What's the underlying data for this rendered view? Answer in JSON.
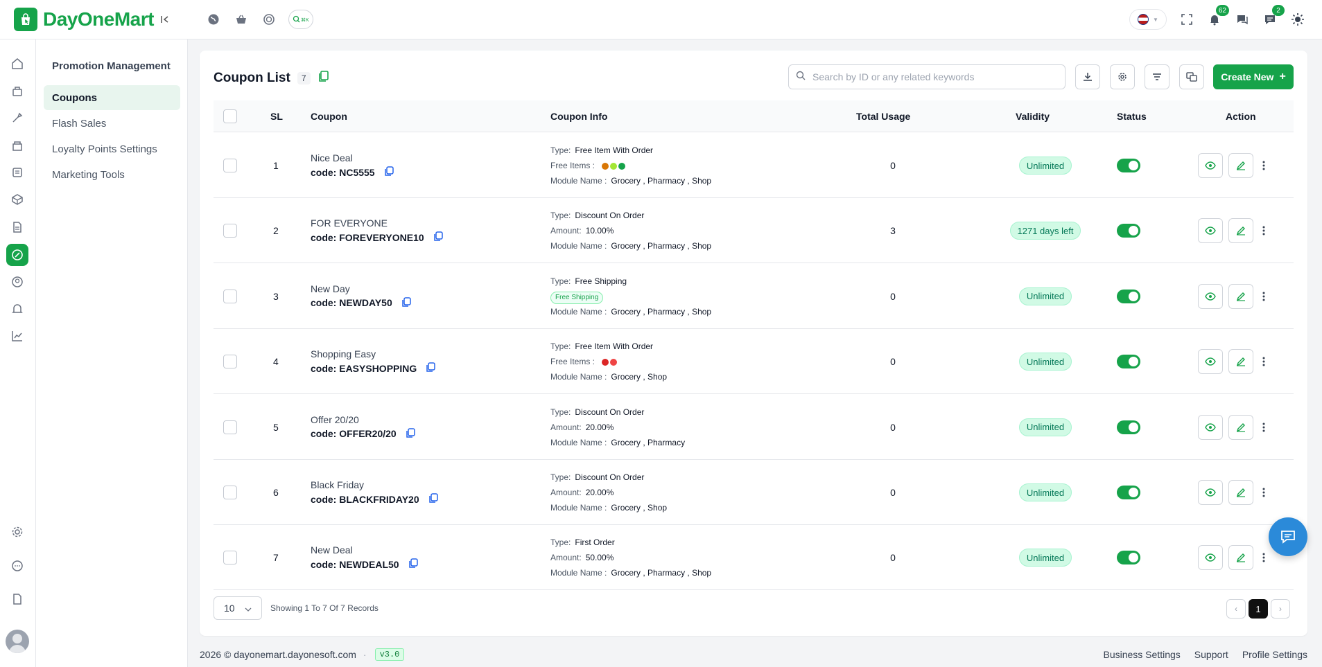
{
  "brand": {
    "name_light": "DayOne",
    "name_bold": "Mart"
  },
  "notifications": {
    "bell_count": "62",
    "message_count": "2"
  },
  "sidebar": {
    "title": "Promotion Management",
    "items": [
      {
        "label": "Coupons"
      },
      {
        "label": "Flash Sales"
      },
      {
        "label": "Loyalty Points Settings"
      },
      {
        "label": "Marketing Tools"
      }
    ]
  },
  "toolbar": {
    "title": "Coupon List",
    "count": "7",
    "search_placeholder": "Search by ID or any related keywords",
    "create_label": "Create New"
  },
  "table": {
    "columns": [
      "SL",
      "Coupon",
      "Coupon Info",
      "Total Usage",
      "Validity",
      "Status",
      "Action"
    ],
    "rows": [
      {
        "sl": "1",
        "name": "Nice Deal",
        "code": "code: NC5555",
        "type_label": "Type:",
        "type": "Free Item With Order",
        "second_label": "Free Items :",
        "second_value": "",
        "module_label": "Module Name :",
        "modules": "Grocery , Pharmacy , Shop",
        "usage": "0",
        "validity": "Unlimited"
      },
      {
        "sl": "2",
        "name": "FOR EVERYONE",
        "code": "code: FOREVERYONE10",
        "type_label": "Type:",
        "type": "Discount On Order",
        "second_label": "Amount:",
        "second_value": "10.00%",
        "module_label": "Module Name :",
        "modules": "Grocery , Pharmacy , Shop",
        "usage": "3",
        "validity": "1271 days left"
      },
      {
        "sl": "3",
        "name": "New Day",
        "code": "code: NEWDAY50",
        "type_label": "Type:",
        "type": "Free Shipping",
        "second_label": "",
        "second_value": "Free Shipping",
        "module_label": "Module Name :",
        "modules": "Grocery , Pharmacy , Shop",
        "usage": "0",
        "validity": "Unlimited"
      },
      {
        "sl": "4",
        "name": "Shopping Easy",
        "code": "code: EASYSHOPPING",
        "type_label": "Type:",
        "type": "Free Item With Order",
        "second_label": "Free Items :",
        "second_value": "",
        "module_label": "Module Name :",
        "modules": "Grocery , Shop",
        "usage": "0",
        "validity": "Unlimited"
      },
      {
        "sl": "5",
        "name": "Offer 20/20",
        "code": "code: OFFER20/20",
        "type_label": "Type:",
        "type": "Discount On Order",
        "second_label": "Amount:",
        "second_value": "20.00%",
        "module_label": "Module Name :",
        "modules": "Grocery , Pharmacy",
        "usage": "0",
        "validity": "Unlimited"
      },
      {
        "sl": "6",
        "name": "Black Friday",
        "code": "code: BLACKFRIDAY20",
        "type_label": "Type:",
        "type": "Discount On Order",
        "second_label": "Amount:",
        "second_value": "20.00%",
        "module_label": "Module Name :",
        "modules": "Grocery , Shop",
        "usage": "0",
        "validity": "Unlimited"
      },
      {
        "sl": "7",
        "name": "New Deal",
        "code": "code: NEWDEAL50",
        "type_label": "Type:",
        "type": "First Order",
        "second_label": "Amount:",
        "second_value": "50.00%",
        "module_label": "Module Name :",
        "modules": "Grocery , Pharmacy , Shop",
        "usage": "0",
        "validity": "Unlimited"
      }
    ]
  },
  "pagination": {
    "page_size": "10",
    "records_text": "Showing 1 To 7 Of 7 Records",
    "current_page": "1"
  },
  "footer": {
    "copyright": "2026 © dayonemart.dayonesoft.com",
    "separator": "·",
    "version": "v3.0",
    "links": [
      "Business Settings",
      "Support",
      "Profile Settings"
    ]
  },
  "colors": {
    "accent": "#16a34a",
    "validity_bg": "#d1fae5",
    "chat": "#2b8ad9"
  }
}
